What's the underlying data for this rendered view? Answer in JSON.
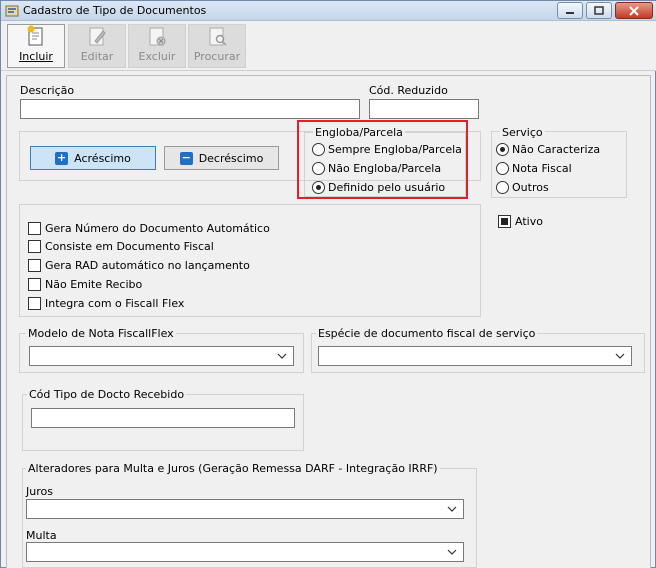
{
  "window": {
    "title": "Cadastro de Tipo de Documentos"
  },
  "toolbar": {
    "incluir": "Incluir",
    "editar": "Editar",
    "excluir": "Excluir",
    "procurar": "Procurar"
  },
  "form": {
    "descricao_label": "Descrição",
    "descricao_value": "",
    "cod_reduzido_label": "Cód. Reduzido",
    "cod_reduzido_value": "",
    "acrescimo_label": "Acréscimo",
    "decrescimo_label": "Decréscimo",
    "engloba": {
      "legend": "Engloba/Parcela",
      "options": [
        "Sempre Engloba/Parcela",
        "Não Engloba/Parcela",
        "Definido pelo usuário"
      ],
      "selected": 2
    },
    "servico": {
      "legend": "Serviço",
      "options": [
        "Não Caracteriza",
        "Nota Fiscal",
        "Outros"
      ],
      "selected": 0
    },
    "ativo": {
      "label": "Ativo",
      "checked": true
    },
    "checkboxes": [
      {
        "label": "Gera Número do Documento Automático",
        "checked": false
      },
      {
        "label": "Consiste em Documento Fiscal",
        "checked": false
      },
      {
        "label": "Gera RAD automático no lançamento",
        "checked": false
      },
      {
        "label": "Não Emite Recibo",
        "checked": false
      },
      {
        "label": "Integra com o Fiscall Flex",
        "checked": false
      }
    ],
    "modelo_nota_legend": "Modelo de Nota FiscallFlex",
    "modelo_nota_value": "",
    "especie_legend": "Espécie de documento fiscal de serviço",
    "especie_value": "",
    "cod_tipo_legend": "Cód Tipo de Docto Recebido",
    "cod_tipo_value": "",
    "alteradores_legend": "Alteradores para Multa e Juros (Geração Remessa DARF - Integração IRRF)",
    "juros_label": "Juros",
    "juros_value": "",
    "multa_label": "Multa",
    "multa_value": ""
  },
  "colors": {
    "highlight": "#e0202a",
    "accent": "#1f6fc4"
  }
}
